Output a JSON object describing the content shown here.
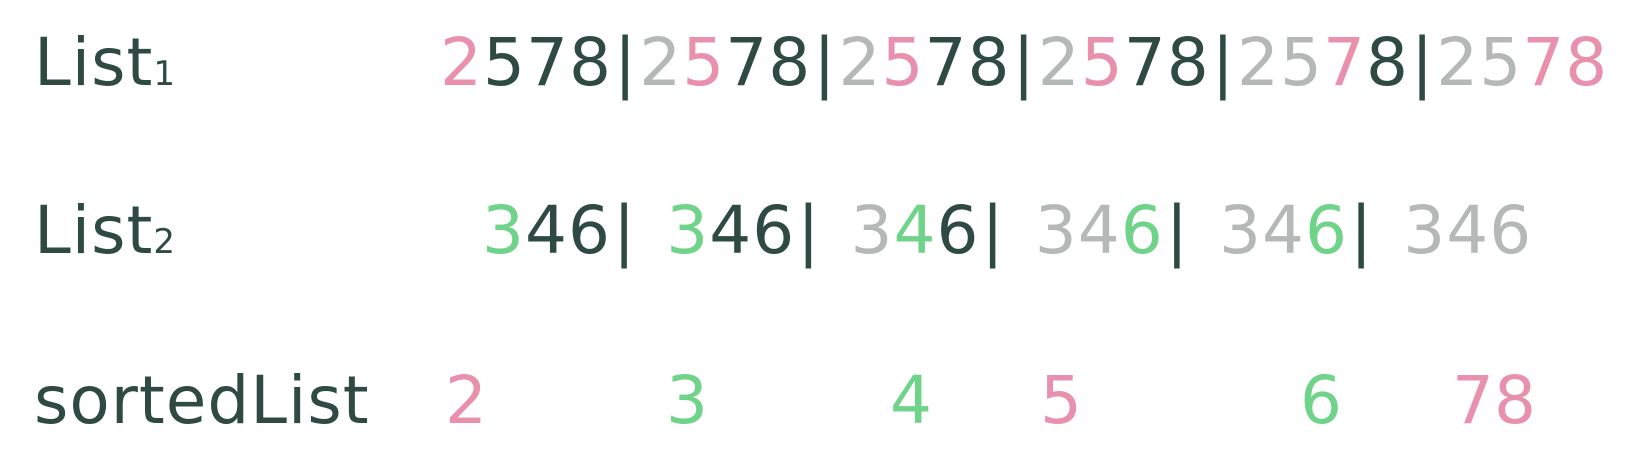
{
  "rows": {
    "list1": {
      "label": "List",
      "subscript": "1"
    },
    "list2": {
      "label": "List",
      "subscript": "2"
    },
    "sorted": {
      "label": "sortedList"
    }
  },
  "list1_sequence": [
    {
      "digit": "2",
      "state": "pink"
    },
    {
      "digit": "5",
      "state": "dark"
    },
    {
      "digit": "7",
      "state": "dark"
    },
    {
      "digit": "8",
      "state": "dark"
    },
    {
      "digit": "|",
      "state": "sep"
    },
    {
      "digit": "2",
      "state": "muted"
    },
    {
      "digit": "5",
      "state": "pink"
    },
    {
      "digit": "7",
      "state": "dark"
    },
    {
      "digit": "8",
      "state": "dark"
    },
    {
      "digit": "|",
      "state": "sep"
    },
    {
      "digit": "2",
      "state": "muted"
    },
    {
      "digit": "5",
      "state": "pink"
    },
    {
      "digit": "7",
      "state": "dark"
    },
    {
      "digit": "8",
      "state": "dark"
    },
    {
      "digit": "|",
      "state": "sep"
    },
    {
      "digit": "2",
      "state": "muted"
    },
    {
      "digit": "5",
      "state": "pink"
    },
    {
      "digit": "7",
      "state": "dark"
    },
    {
      "digit": "8",
      "state": "dark"
    },
    {
      "digit": "|",
      "state": "sep"
    },
    {
      "digit": "2",
      "state": "muted"
    },
    {
      "digit": "5",
      "state": "muted"
    },
    {
      "digit": "7",
      "state": "pink"
    },
    {
      "digit": "8",
      "state": "dark"
    },
    {
      "digit": "|",
      "state": "sep"
    },
    {
      "digit": "2",
      "state": "muted"
    },
    {
      "digit": "5",
      "state": "muted"
    },
    {
      "digit": "7",
      "state": "pink"
    },
    {
      "digit": "8",
      "state": "pink"
    }
  ],
  "list2_sequence": [
    {
      "digit": "3",
      "state": "green"
    },
    {
      "digit": "4",
      "state": "dark"
    },
    {
      "digit": "6",
      "state": "dark"
    },
    {
      "digit": "|",
      "state": "sep"
    },
    {
      "digit": "3",
      "state": "green"
    },
    {
      "digit": "4",
      "state": "dark"
    },
    {
      "digit": "6",
      "state": "dark"
    },
    {
      "digit": "|",
      "state": "sep"
    },
    {
      "digit": "3",
      "state": "muted"
    },
    {
      "digit": "4",
      "state": "green"
    },
    {
      "digit": "6",
      "state": "dark"
    },
    {
      "digit": "|",
      "state": "sep"
    },
    {
      "digit": "3",
      "state": "muted"
    },
    {
      "digit": "4",
      "state": "muted"
    },
    {
      "digit": "6",
      "state": "green"
    },
    {
      "digit": "|",
      "state": "sep"
    },
    {
      "digit": "3",
      "state": "muted"
    },
    {
      "digit": "4",
      "state": "muted"
    },
    {
      "digit": "6",
      "state": "green"
    },
    {
      "digit": "|",
      "state": "sep"
    },
    {
      "digit": "3",
      "state": "muted"
    },
    {
      "digit": "4",
      "state": "muted"
    },
    {
      "digit": "6",
      "state": "muted"
    }
  ],
  "sorted_list": [
    {
      "digit": "2",
      "source": "pink"
    },
    {
      "digit": "3",
      "source": "green"
    },
    {
      "digit": "4",
      "source": "green"
    },
    {
      "digit": "5",
      "source": "pink"
    },
    {
      "digit": "6",
      "source": "green"
    },
    {
      "digit": "78",
      "source": "pink"
    }
  ],
  "colors": {
    "list1_accent": "#e991ac",
    "list2_accent": "#6fd489",
    "text": "#2f4a42",
    "consumed": "#b4b8b6"
  }
}
